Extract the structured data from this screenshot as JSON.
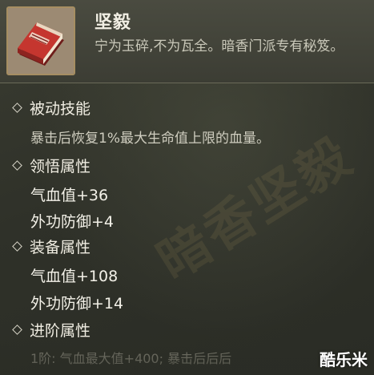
{
  "item": {
    "name": "坚毅",
    "description": "宁为玉碎,不为瓦全。暗香门派专有秘笈。"
  },
  "sections": {
    "passive": {
      "title": "被动技能",
      "text": "暴击后恢复1%最大生命值上限的血量。"
    },
    "comprehension": {
      "title": "领悟属性",
      "stats": [
        "气血值+36",
        "外功防御+4"
      ]
    },
    "equipment": {
      "title": "装备属性",
      "stats": [
        "气血值+108",
        "外功防御+14"
      ]
    },
    "advanced": {
      "title": "进阶属性",
      "text": "1阶: 气血最大值+400; 暴击后后后"
    }
  },
  "watermark": "暗香坚毅",
  "logo": "酷乐米",
  "icons": {
    "item_icon": "red-book-icon",
    "bullet": "diamond-bullet-icon"
  },
  "colors": {
    "background": "#2f3129",
    "header": "#45463c",
    "frame": "#a68e62",
    "book_red": "#b7312b"
  }
}
